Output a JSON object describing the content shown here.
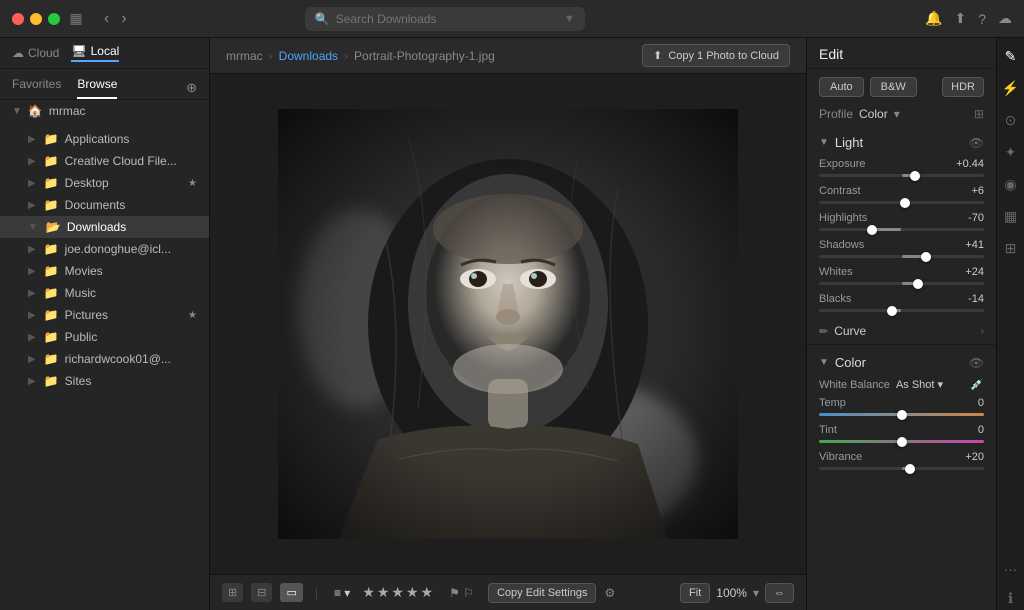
{
  "titlebar": {
    "search_placeholder": "Search Downloads",
    "window_icon": "▦"
  },
  "sidebar": {
    "cloud_label": "Cloud",
    "local_label": "Local",
    "tabs": {
      "favorites": "Favorites",
      "browse": "Browse"
    },
    "user": "mrmac",
    "items": [
      {
        "label": "Applications",
        "star": false,
        "active": false
      },
      {
        "label": "Creative Cloud File...",
        "star": false,
        "active": false
      },
      {
        "label": "Desktop",
        "star": true,
        "active": false
      },
      {
        "label": "Documents",
        "star": false,
        "active": false
      },
      {
        "label": "Downloads",
        "star": false,
        "active": true
      },
      {
        "label": "joe.donoghue@icl...",
        "star": false,
        "active": false
      },
      {
        "label": "Movies",
        "star": false,
        "active": false
      },
      {
        "label": "Music",
        "star": false,
        "active": false
      },
      {
        "label": "Pictures",
        "star": true,
        "active": false
      },
      {
        "label": "Public",
        "star": false,
        "active": false
      },
      {
        "label": "richardwcook01@...",
        "star": false,
        "active": false
      },
      {
        "label": "Sites",
        "star": false,
        "active": false
      }
    ]
  },
  "breadcrumb": {
    "user": "mrmac",
    "folder": "Downloads",
    "file": "Portrait-Photography-1.jpg"
  },
  "copy_btn": "Copy 1 Photo to Cloud",
  "footer": {
    "view_icons": [
      "grid",
      "columns",
      "filmstrip"
    ],
    "stars": "★★★★★",
    "flags": "⚑ ⚐",
    "copy_edit": "Copy Edit Settings",
    "fit": "Fit",
    "zoom": "100%"
  },
  "edit": {
    "title": "Edit",
    "auto_btn": "Auto",
    "bw_btn": "B&W",
    "hdr_btn": "HDR",
    "profile_label": "Profile",
    "profile_value": "Color",
    "sections": {
      "light": {
        "title": "Light",
        "sliders": [
          {
            "label": "Exposure",
            "value": "+0.44",
            "pct": 58
          },
          {
            "label": "Contrast",
            "value": "+6",
            "pct": 52
          },
          {
            "label": "Highlights",
            "value": "-70",
            "pct": 32
          },
          {
            "label": "Shadows",
            "value": "+41",
            "pct": 65
          },
          {
            "label": "Whites",
            "value": "+24",
            "pct": 60
          },
          {
            "label": "Blacks",
            "value": "-14",
            "pct": 44
          }
        ]
      },
      "curve": {
        "label": "Curve"
      },
      "color": {
        "title": "Color",
        "wb_label": "White Balance",
        "wb_value": "As Shot",
        "sliders": [
          {
            "label": "Temp",
            "value": "0",
            "pct": 50,
            "type": "temp"
          },
          {
            "label": "Tint",
            "value": "0",
            "pct": 50,
            "type": "tint"
          },
          {
            "label": "Vibrance",
            "value": "+20",
            "pct": 55
          }
        ]
      }
    }
  },
  "right_panel_icons": [
    "edit",
    "adjust",
    "brush",
    "healing",
    "radial",
    "gradient",
    "crop",
    "info"
  ]
}
